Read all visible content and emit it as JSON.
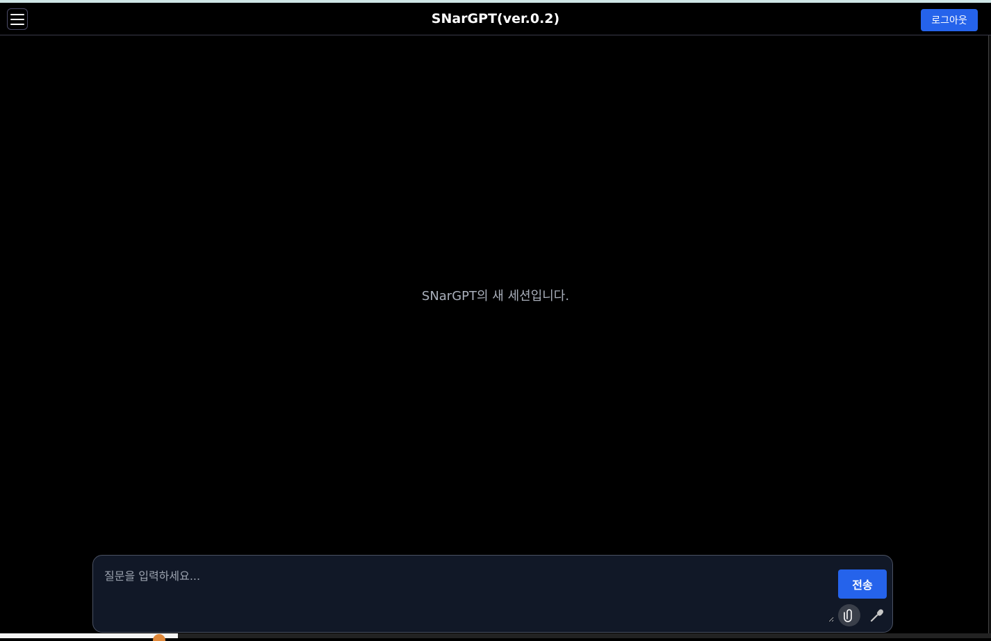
{
  "header": {
    "title": "SNarGPT(ver.0.2)",
    "menu_icon": "hamburger-menu-icon",
    "logout_label": "로그아웃"
  },
  "main": {
    "welcome_text": "SNarGPT의 새 세션입니다."
  },
  "composer": {
    "placeholder": "질문을 입력하세요...",
    "value": "",
    "send_label": "전송",
    "attach_icon": "paperclip-icon",
    "mic_icon": "microphone-icon"
  },
  "colors": {
    "accent": "#2563eb",
    "background": "#000000",
    "composer_bg": "#111827"
  }
}
